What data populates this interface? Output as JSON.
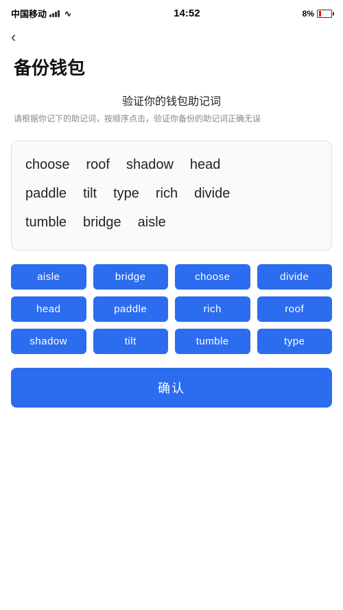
{
  "statusBar": {
    "carrier": "中国移动",
    "time": "14:52",
    "batteryPercent": "8%",
    "batteryIcon": "battery-icon",
    "wifiIcon": "wifi-icon"
  },
  "nav": {
    "backIcon": "‹"
  },
  "page": {
    "title": "备份钱包"
  },
  "instruction": {
    "title": "验证你的钱包助记词",
    "desc": "请根据你记下的助记词，按顺序点击，验证你备份的助记词正确无误"
  },
  "wordDisplay": {
    "rows": [
      [
        "choose",
        "roof",
        "shadow",
        "head"
      ],
      [
        "paddle",
        "tilt",
        "type",
        "rich",
        "divide"
      ],
      [
        "tumble",
        "bridge",
        "aisle"
      ]
    ]
  },
  "wordButtons": [
    "aisle",
    "bridge",
    "choose",
    "divide",
    "head",
    "paddle",
    "rich",
    "roof",
    "shadow",
    "tilt",
    "tumble",
    "type"
  ],
  "confirmButton": {
    "label": "确认"
  }
}
